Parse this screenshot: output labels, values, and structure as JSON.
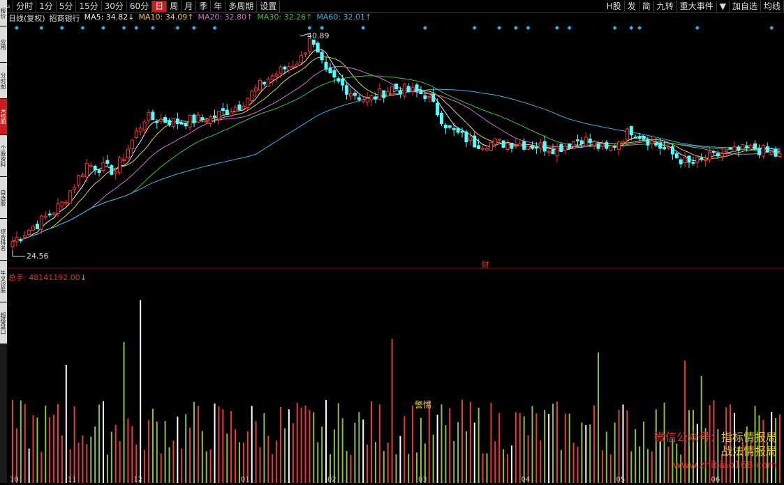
{
  "toolbar": {
    "back_arrow": "⇦",
    "periods": [
      "分时",
      "1分",
      "5分",
      "15分",
      "30分",
      "60分",
      "日",
      "周",
      "月",
      "季",
      "年",
      "多周期",
      "设置"
    ],
    "active_period": "日",
    "right_items": [
      "H股",
      "发",
      "简",
      "九转",
      "重大事件",
      "▼",
      "加自选",
      "均线"
    ]
  },
  "sidebar": {
    "tabs": [
      "报价",
      "应用",
      "分时图",
      "K线图",
      "个股资料",
      "自选股",
      "综合排名",
      "牛叉诊股",
      "超级盘口"
    ],
    "active": "K线图"
  },
  "legend": {
    "title": "日线(复权)",
    "stock": "招商银行",
    "ma": [
      {
        "label": "MA5: 34.82↓",
        "color": "#e8e8e8"
      },
      {
        "label": "MA10: 34.09↑",
        "color": "#e6d22a"
      },
      {
        "label": "MA20: 32.80↑",
        "color": "#d070d0"
      },
      {
        "label": "MA30: 32.26↑",
        "color": "#40c040"
      },
      {
        "label": "MA60: 32.01↑",
        "color": "#3ab0e8"
      }
    ]
  },
  "price_labels": {
    "high": "40.89",
    "low": "24.56",
    "event": "财"
  },
  "volume_legend": {
    "label": "总手: ",
    "value": "48141192.00",
    "arrow": "↓"
  },
  "volume_annotation": "警惕",
  "x_axis_ticks": [
    "10",
    "11",
    "12",
    "01",
    "02",
    "03",
    "04",
    "05",
    "06"
  ],
  "watermark": {
    "line1a": "微信公众号：",
    "line1b": "指标情报局",
    "line2": "战法情报局",
    "url": "www.zhibiao168.com"
  },
  "colors": {
    "up": "#ff3232",
    "down": "#54ffff",
    "vol_up": "#e83c3c",
    "vol_down": "#8fbf3f",
    "vol_flat": "#ffffff",
    "signal": "#3ab0e8"
  },
  "chart_data": {
    "type": "candlestick",
    "title": "日线(复权) 招商银行",
    "y_high": 40.89,
    "y_low": 24.56,
    "anchors": [
      {
        "i": 0,
        "close": 25.2
      },
      {
        "i": 6,
        "close": 26.5
      },
      {
        "i": 12,
        "close": 28.0
      },
      {
        "i": 18,
        "close": 31.0
      },
      {
        "i": 25,
        "close": 30.5
      },
      {
        "i": 32,
        "close": 34.5
      },
      {
        "i": 40,
        "close": 34.2
      },
      {
        "i": 48,
        "close": 34.5
      },
      {
        "i": 55,
        "close": 35.5
      },
      {
        "i": 62,
        "close": 37.5
      },
      {
        "i": 70,
        "close": 39.0
      },
      {
        "i": 72,
        "close": 40.5
      },
      {
        "i": 76,
        "close": 37.8
      },
      {
        "i": 82,
        "close": 36.5
      },
      {
        "i": 86,
        "close": 35.8
      },
      {
        "i": 92,
        "close": 36.8
      },
      {
        "i": 100,
        "close": 36.3
      },
      {
        "i": 106,
        "close": 33.6
      },
      {
        "i": 112,
        "close": 32.6
      },
      {
        "i": 122,
        "close": 32.6
      },
      {
        "i": 132,
        "close": 32.2
      },
      {
        "i": 138,
        "close": 33.0
      },
      {
        "i": 144,
        "close": 32.0
      },
      {
        "i": 150,
        "close": 33.6
      },
      {
        "i": 156,
        "close": 32.5
      },
      {
        "i": 164,
        "close": 31.0
      },
      {
        "i": 172,
        "close": 31.8
      },
      {
        "i": 180,
        "close": 32.2
      },
      {
        "i": 186,
        "close": 31.6
      }
    ],
    "bar_count": 187
  }
}
